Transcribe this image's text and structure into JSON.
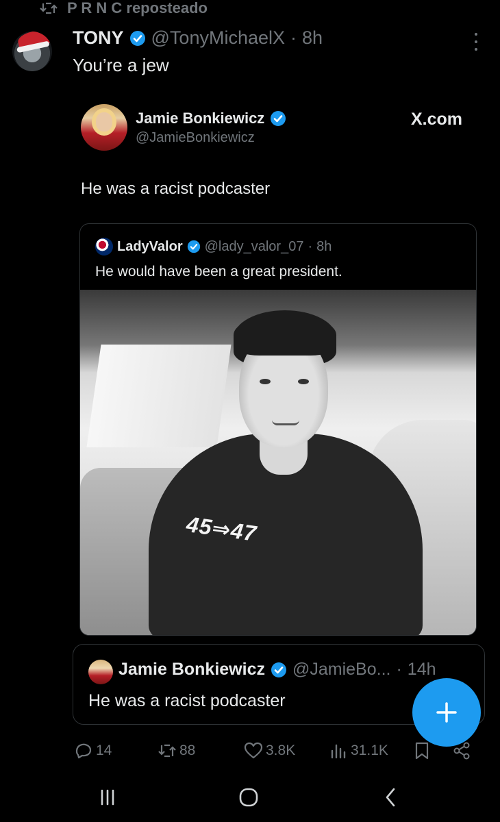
{
  "repost": {
    "label": "P R N C reposteado"
  },
  "post": {
    "author_name": "TONY",
    "author_handle": "@TonyMichaelX",
    "separator": "·",
    "time": "8h",
    "text": "You’re a jew"
  },
  "embedded_post": {
    "author_name": "Jamie Bonkiewicz",
    "author_handle": "@JamieBonkiewicz",
    "source_label": "X.com",
    "text": "He was a racist podcaster",
    "quoted": {
      "author_name": "LadyValor",
      "author_handle": "@lady_valor_07",
      "separator": "·",
      "time": "8h",
      "text": "He would have been a great president.",
      "image_text": "45⇒47"
    }
  },
  "quoted_post": {
    "author_name": "Jamie Bonkiewicz",
    "author_handle": "@JamieBo...",
    "separator": "·",
    "time": "14h",
    "text": "He was a racist podcaster"
  },
  "actions": {
    "replies": "14",
    "reposts": "88",
    "likes": "3.8K",
    "views": "31.1K"
  },
  "colors": {
    "background": "#000000",
    "text": "#e7e9ea",
    "secondary_text": "#71767b",
    "accent": "#1d9bf0",
    "border": "#2f3336"
  },
  "icons": {
    "repost": "repost-icon",
    "verified": "verified-badge-icon",
    "more": "more-vertical-icon",
    "reply": "reply-icon",
    "like": "heart-icon",
    "views": "views-icon",
    "bookmark": "bookmark-icon",
    "share": "share-icon",
    "compose": "plus-icon",
    "nav_recent": "recent-apps-icon",
    "nav_home": "home-icon",
    "nav_back": "back-icon"
  }
}
